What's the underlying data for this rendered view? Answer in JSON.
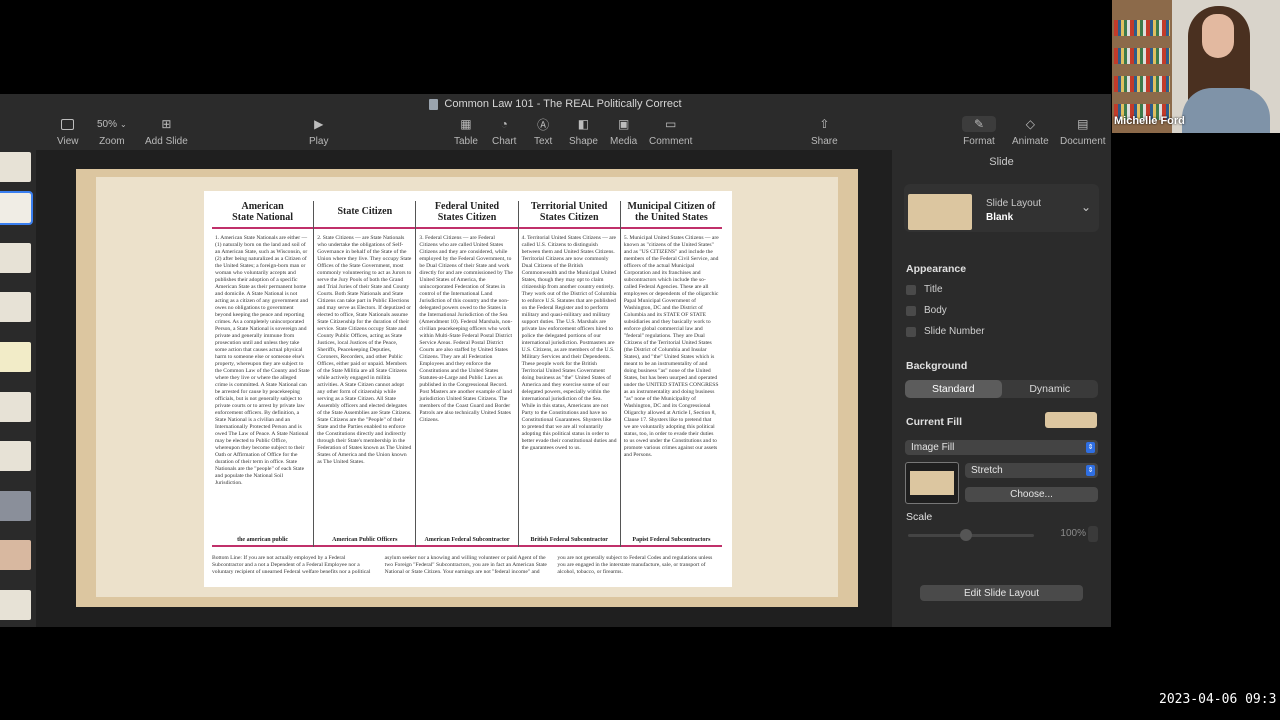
{
  "window": {
    "title": "Common Law 101 - The REAL Politically Correct"
  },
  "toolbar": {
    "view": "View",
    "zoom_value": "50%",
    "zoom": "Zoom",
    "add_slide": "Add Slide",
    "play": "Play",
    "table": "Table",
    "chart": "Chart",
    "text": "Text",
    "shape": "Shape",
    "media": "Media",
    "comment": "Comment",
    "share": "Share",
    "format": "Format",
    "animate": "Animate",
    "document": "Document"
  },
  "slide": {
    "columns": [
      {
        "header": "American\nState National",
        "body": "1. American State Nationals are either — (1) naturally born on the land and soil of an American State, such as Wisconsin, or (2) after being naturalized as a Citizen of the United States; a foreign-born man or woman who voluntarily accepts and publishes their adoption of a specific American State as their permanent home and domicile. A State National is not acting as a citizen of any government and owes no obligations to government beyond keeping the peace and reporting crimes. As a completely unincorporated Person, a State National is sovereign and private and generally immune from prosecution until and unless they take some action that causes actual physical harm to someone else or someone else's property, whereupon they are subject to the Common Law of the County and State where they live or where the alleged crime is committed. A State National can be arrested for cause by peacekeeping officials, but is not generally subject to private courts or to arrest by private law enforcement officers. By definition, a State National is a civilian and an Internationally Protected Person and is owed The Law of Peace. A State National may be elected to Public Office, whereupon they become subject to their Oath or Affirmation of Office for the duration of their term in office. State Nationals are the \"people\" of each State and populate the National Soil Jurisdiction.",
        "footer": "the american public"
      },
      {
        "header": "State Citizen",
        "body": "2. State Citizens — are State Nationals who undertake the obligations of Self-Governance in behalf of the State of the Union where they live. They occupy State Offices of the State Government, most commonly volunteering to act as Jurors to serve the Jury Pools of both the Grand and Trial Juries of their State and County Courts. Both State Nationals and State Citizens can take part in Public Elections and may serve as Electors. If deputized or elected to office, State Nationals assume State Citizenship for the duration of their service. State Citizens occupy State and County Public Offices, acting as State Justices, local Justices of the Peace, Sheriffs, Peacekeeping Deputies, Coroners, Recorders, and other Public Offices, either paid or unpaid. Members of the State Militia are all State Citizens while actively engaged in militia activities. A State Citizen cannot adopt any other form of citizenship while serving as a State Citizen. All State Assembly officers and elected delegates of the State Assemblies are State Citizens. State Citizens are the \"People\" of their State and the Parties enabled to enforce the Constitutions directly and indirectly through their State's membership in the Federation of States known as The United States of America and the Union known as The United States.",
        "footer": "American Public Officers"
      },
      {
        "header": "Federal United\nStates Citizen",
        "body": "3. Federal Citizens — are Federal Citizens who are called United States Citizens and they are considered, while employed by the Federal Government, to be Dual Citizens of their State and work directly for and are commissioned by The United States of America, the unincorporated Federation of States in control of the International Land Jurisdiction of this country and the non-delegated powers owed to the States in the International Jurisdiction of the Sea (Amendment 10). Federal Marshals, non-civilian peacekeeping officers who work within Multi-State Federal Postal District Service Areas. Federal Postal District Courts are also staffed by United States Citizens. They are all Federation Employees and they enforce the Constitutions and the United States Statutes-at-Large and Public Laws as published in the Congressional Record. Post Masters are another example of land jurisdiction United States Citizens. The members of the Coast Guard and Border Patrols are also technically United States Citizens.",
        "footer": "American Federal Subcontractor"
      },
      {
        "header": "Territorial United\nStates Citizen",
        "body": "4. Territorial United States Citizens — are called U.S. Citizens to distinguish between them and United States Citizens. Territorial Citizens are now commonly Dual Citizens of the British Commonwealth and the Municipal United States, though they may opt to claim citizenship from another country entirely. They work out of the District of Columbia to enforce U.S. Statutes that are published on the Federal Register and to perform military and quasi-military and military support duties. The U.S. Marshals are private law enforcement officers hired to police the delegated portions of our international jurisdiction. Postmasters are U.S. Citizens, as are members of the U.S. Military Services and their Dependents. These people work for the British Territorial United States Government doing business as \"the\" United States of America and they exercise some of our delegated powers, especially within the international jurisdiction of the Sea. While in this status, Americans are not Party to the Constitutions and have no Constitutional Guarantees. Shysters like to pretend that we are all voluntarily adopting this political status in order to better evade their constitutional duties and the guarantees owed to us.",
        "footer": "British Federal Subcontractor"
      },
      {
        "header": "Municipal Citizen of\nthe United States",
        "body": "5. Municipal United States Citizens — are known as \"citizens of the United States\" and as \"US CITIZENS\" and include the members of the Federal Civil Service, and officers of the actual Municipal Corporation and its franchises and subcontractors which include the so-called Federal Agencies. These are all employees or dependents of the oligarchic Papal Municipal Government of Washington, DC and the District of Columbia and its STATE OF STATE subsidiaries and they basically work to enforce global commercial law and \"federal\" regulations. They are Dual Citizens of the Territorial United States (the District of Columbia and Insular States), and \"the\" United States which is meant to be an instrumentality of and doing business \"as\" none of the United States, but has been usurped and operated under the UNITED STATES CONGRESS as an instrumentality and doing business \"as\" none of the Municipality of Washington, DC and its Congressional Oligarchy allowed at Article I, Section 8, Clause 17. Shysters like to pretend that we are voluntarily adopting this political status, too, in order to evade their duties to us owed under the Constitutions and to promote various crimes against our assets and Persons.",
        "footer": "Papist Federal Subcontractors"
      }
    ],
    "bottom_text": "Bottom Line: If you are not actually employed by a Federal Subcontractor and a not a Dependent of a Federal Employee nor a voluntary recipient of unearned Federal welfare benefits nor a political asylum seeker nor a knowing and willing volunteer or paid Agent of the two Foreign \"Federal\" Subcontractors, you are in fact an American State National or State Citizen. Your earnings are not \"federal income\" and you are not generally subject to Federal Codes and regulations unless you are engaged in the interstate manufacture, sale, or transport of alcohol, tobacco, or firearms."
  },
  "format_panel": {
    "tab_title": "Slide",
    "slide_layout_label": "Slide Layout",
    "slide_layout_value": "Blank",
    "appearance": "Appearance",
    "checkboxes": [
      "Title",
      "Body",
      "Slide Number"
    ],
    "background": "Background",
    "bg_modes": [
      "Standard",
      "Dynamic"
    ],
    "current_fill": "Current Fill",
    "fill_type": "Image Fill",
    "scale_mode": "Stretch",
    "choose": "Choose...",
    "scale": "Scale",
    "scale_value": "100%",
    "edit_layout": "Edit Slide Layout",
    "fill_color": "#dcc6a0"
  },
  "webcam": {
    "name": "Michelle Ford"
  },
  "timestamp": "2023-04-06 09:3"
}
